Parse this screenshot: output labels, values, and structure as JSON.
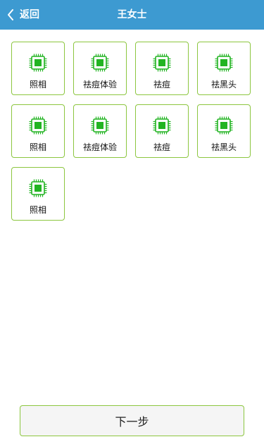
{
  "header": {
    "back_label": "返回",
    "title": "王女士",
    "back_icon": "chevron-left-icon",
    "bg_color": "#3d9ad1"
  },
  "tiles": [
    {
      "label": "照相",
      "icon": "chip-icon"
    },
    {
      "label": "祛痘体验",
      "icon": "chip-icon"
    },
    {
      "label": "祛痘",
      "icon": "chip-icon"
    },
    {
      "label": "祛黑头",
      "icon": "chip-icon"
    },
    {
      "label": "照相",
      "icon": "chip-icon"
    },
    {
      "label": "祛痘体验",
      "icon": "chip-icon"
    },
    {
      "label": "祛痘",
      "icon": "chip-icon"
    },
    {
      "label": "祛黑头",
      "icon": "chip-icon"
    },
    {
      "label": "照相",
      "icon": "chip-icon"
    }
  ],
  "footer": {
    "next_label": "下一步"
  },
  "colors": {
    "accent_border": "#8cc63f",
    "icon_green": "#22b422"
  }
}
